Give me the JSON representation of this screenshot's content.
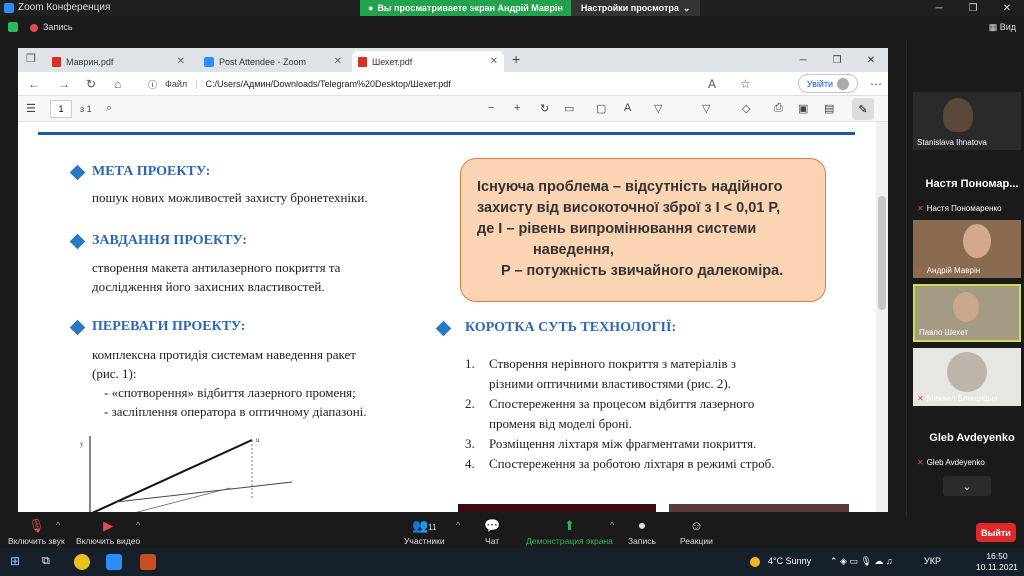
{
  "zoom": {
    "window_title": "Zoom Конференция",
    "viewing": "Вы просматриваете экран Андрій Маврін",
    "view_settings": "Настройки просмотра",
    "record": "Запись",
    "view": "Вид"
  },
  "browser": {
    "tabs": [
      {
        "label": "Маврин.pdf"
      },
      {
        "label": "Post Attendee - Zoom"
      },
      {
        "label": "Шехет.pdf"
      }
    ],
    "url_label": "Файл",
    "url": "C:/Users/Админ/Downloads/Telegram%20Desktop/Шехет.pdf",
    "login": "Увійти"
  },
  "pdf": {
    "page": "1",
    "of": "з 1"
  },
  "doc": {
    "goal_h": "МЕТА ПРОЕКТУ:",
    "goal_t": "пошук нових можливостей захисту бронетехніки.",
    "task_h": "ЗАВДАННЯ ПРОЕКТУ:",
    "task_t1": "створення макета антилазерного покриття та",
    "task_t2": "дослідження його захисних властивостей.",
    "adv_h": "ПЕРЕВАГИ ПРОЕКТУ:",
    "adv_t1": "комплексна протидія системам наведення ракет",
    "adv_t2": "(рис. 1):",
    "adv_t3": "- «спотворення» відбиття лазерного променя;",
    "adv_t4": "- засліплення оператора в оптичному діапазоні.",
    "callout": [
      "Існуюча проблема – відсутність надійного",
      "захисту від високоточної зброї з I < 0,01 P,",
      "де I – рівень випромінювання системи",
      "наведення,",
      "P – потужність звичайного далекоміра."
    ],
    "tech_h": "КОРОТКА СУТЬ ТЕХНОЛОГІЇ:",
    "tech": [
      {
        "n": "1.",
        "t": "Створення нерівного покриття з матеріалів  з"
      },
      {
        "n": "",
        "t": "різними оптичними властивостями (рис. 2)."
      },
      {
        "n": "2.",
        "t": " Спостереження за процесом відбиття лазерного"
      },
      {
        "n": "",
        "t": "променя від моделі броні."
      },
      {
        "n": "3.",
        "t": "Розміщення ліхтаря між фрагментами покриття."
      },
      {
        "n": "4.",
        "t": "Спостереження за роботою ліхтаря в режимі строб."
      }
    ]
  },
  "participants": [
    {
      "name": "Stanislava Ihnatova"
    },
    {
      "big": "Настя Пономар...",
      "name": "Настя Пономаренко"
    },
    {
      "name": "Андрій Маврін"
    },
    {
      "name": "Павло Шехет"
    },
    {
      "name": "Михаил Блощицын"
    },
    {
      "big": "Gleb Avdeyenko",
      "name": "Gleb Avdeyenko"
    }
  ],
  "controls": {
    "mute": "Включить звук",
    "video": "Включить видео",
    "participants": "Участники",
    "count": "11",
    "chat": "Чат",
    "share": "Демонстрация экрана",
    "record": "Запись",
    "reactions": "Реакции",
    "leave": "Выйти"
  },
  "taskbar": {
    "weather": "4°C  Sunny",
    "lang": "УКР",
    "time": "16:50",
    "date": "10.11.2021"
  }
}
